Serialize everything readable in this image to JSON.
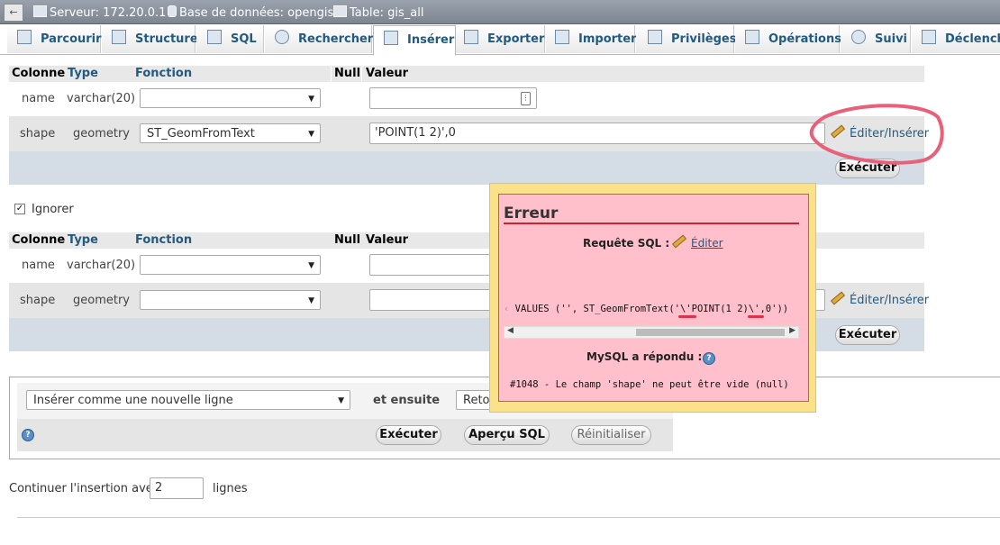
{
  "breadcrumb": {
    "server": "Serveur: 172.20.0.1 »",
    "database": "Base de données: opengis »",
    "table": "Table: gis_all"
  },
  "tabs": [
    {
      "label": "Parcourir",
      "icon": "browse-icon"
    },
    {
      "label": "Structure",
      "icon": "structure-icon"
    },
    {
      "label": "SQL",
      "icon": "sql-icon"
    },
    {
      "label": "Rechercher",
      "icon": "search-icon"
    },
    {
      "label": "Insérer",
      "icon": "insert-icon",
      "active": true
    },
    {
      "label": "Exporter",
      "icon": "export-icon"
    },
    {
      "label": "Importer",
      "icon": "import-icon"
    },
    {
      "label": "Privilèges",
      "icon": "privileges-icon"
    },
    {
      "label": "Opérations",
      "icon": "wrench-icon"
    },
    {
      "label": "Suivi",
      "icon": "eye-icon"
    },
    {
      "label": "Déclencheurs",
      "icon": "trigger-icon"
    }
  ],
  "columns_header": {
    "colonne": "Colonne",
    "type": "Type",
    "fonction": "Fonction",
    "null": "Null",
    "valeur": "Valeur"
  },
  "form1": {
    "row_name": {
      "colonne": "name",
      "type": "varchar(20)",
      "fonction": "",
      "valeur": ""
    },
    "row_shape": {
      "colonne": "shape",
      "type": "geometry",
      "fonction": "ST_GeomFromText",
      "valeur": "'POINT(1 2)',0",
      "edit_link": "Éditer/Insérer"
    },
    "execute": "Exécuter"
  },
  "ignore_label": "Ignorer",
  "ignore_checked": true,
  "form2": {
    "row_name": {
      "colonne": "name",
      "type": "varchar(20)",
      "fonction": "",
      "valeur": ""
    },
    "row_shape": {
      "colonne": "shape",
      "type": "geometry",
      "fonction": "",
      "valeur": "",
      "edit_link": "Éditer/Insérer"
    },
    "execute": "Exécuter"
  },
  "insert_options": {
    "mode_select": "Insérer comme une nouvelle ligne",
    "then_label": "et ensuite",
    "then_select": "Reto",
    "execute": "Exécuter",
    "preview": "Aperçu SQL",
    "reset": "Réinitialiser"
  },
  "continue": {
    "prefix": "Continuer l'insertion avec",
    "value": "2",
    "suffix": "lignes"
  },
  "error_modal": {
    "title": "Erreur",
    "sql_label": "Requête SQL :",
    "edit_link": "Éditer",
    "sql_snippet": "VALUES ('', ST_GeomFromText('\\'POINT(1 2)\\',0'))",
    "mysql_label": "MySQL a répondu :",
    "message": "#1048 - Le champ 'shape' ne peut être vide (null)"
  },
  "colors": {
    "accent": "#235a81",
    "error_bg": "#ffc0cb",
    "modal_border": "#fbe28a",
    "annotation": "#e8607a"
  }
}
